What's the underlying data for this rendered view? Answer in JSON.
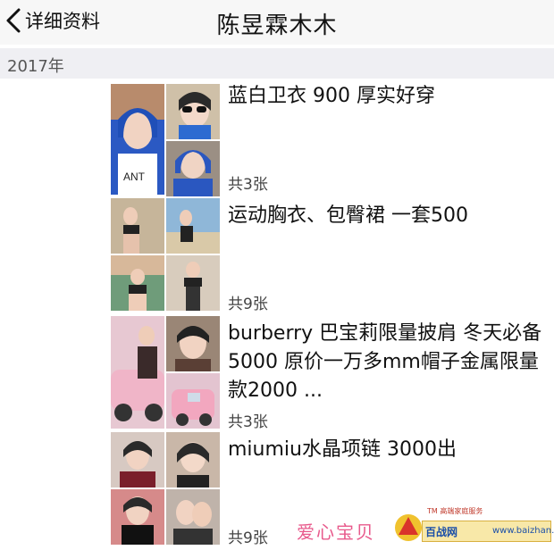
{
  "nav": {
    "back_label": "详细资料",
    "title": "陈昱霖木木"
  },
  "year": "2017年",
  "posts": [
    {
      "text": "蓝白卫衣 900 厚实好穿",
      "count": "共3张"
    },
    {
      "text": "运动胸衣、包臀裙 一套500",
      "count": "共9张"
    },
    {
      "text": "burberry 巴宝莉限量披肩 冬天必备5000 原价一万多mm帽子金属限量款2000 ...",
      "count": "共3张"
    },
    {
      "text": "miumiu水晶项链 3000出",
      "count": "共9张"
    }
  ],
  "watermark": {
    "text": "爱心宝贝",
    "tm": "TM 高端家庭服务",
    "site_name": "百战网",
    "site_url": "www.baizhan.net"
  }
}
